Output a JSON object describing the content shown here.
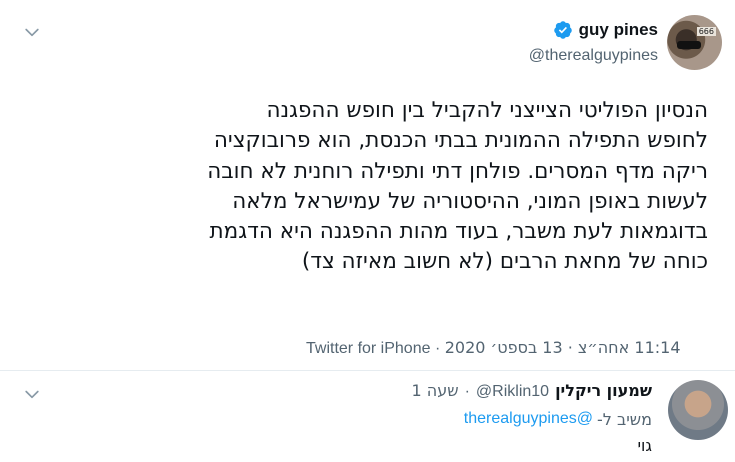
{
  "tweet": {
    "display_name": "guy pines",
    "handle": "@therealguypines",
    "text": "הנסיון הפוליטי הצייצני להקביל בין חופש ההפגנה\nלחופש התפילה ההמונית בבתי הכנסת, הוא פרובוקציה\nריקה מדף המסרים. פולחן דתי ותפילה רוחנית לא חובה\nלעשות באופן המוני, ההיסטוריה של עמישראל מלאה\nבדוגמאות לעת משבר, בעוד מהות ההפגנה היא הדגמת\nכוחה של מחאת הרבים  (לא חשוב מאיזה צד)",
    "time": "11:14 אחה״צ · 13 בספט׳ 2020",
    "separator": "·",
    "source": "Twitter for iPhone",
    "avatar_tag": "666"
  },
  "reply": {
    "display_name": "שמעון ריקלין",
    "handle": "@Riklin10",
    "separator": "·",
    "time": "שעה 1",
    "reply_label": "משיב ל-",
    "reply_to_handle": "therealguypines@",
    "text": "גוי"
  },
  "icons": {
    "verified": "verified-badge-icon",
    "more": "chevron-down-icon"
  },
  "colors": {
    "accent": "#1d9bf0",
    "secondary_text": "#536471",
    "divider": "#e6ecf0"
  }
}
